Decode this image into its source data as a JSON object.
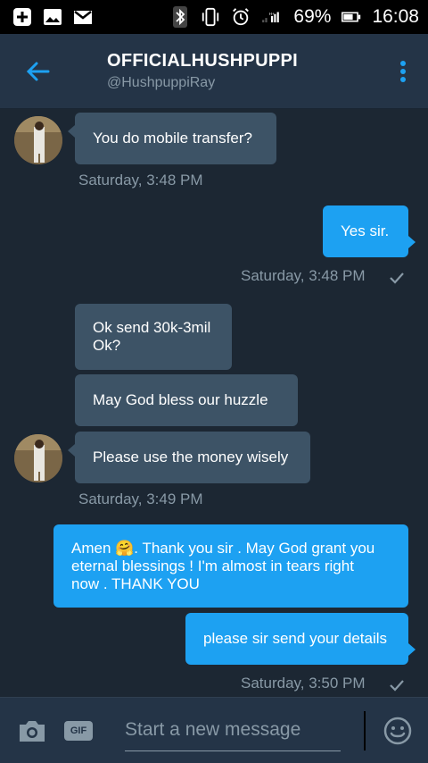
{
  "status_bar": {
    "battery_percent": "69%",
    "time": "16:08"
  },
  "header": {
    "title": "OFFICIALHUSHPUPPI",
    "handle": "@HushpuppiRay"
  },
  "messages": [
    {
      "direction": "in",
      "lines": [
        "You do mobile transfer?"
      ]
    },
    {
      "direction": "out",
      "lines": [
        "Yes sir."
      ]
    },
    {
      "direction": "in",
      "lines": [
        "Ok send 30k-3mil",
        "Ok?"
      ]
    },
    {
      "direction": "in",
      "lines": [
        "May God bless our huzzle"
      ]
    },
    {
      "direction": "in",
      "lines": [
        "Please use the money wisely"
      ]
    },
    {
      "direction": "out",
      "lines": [
        "Amen 🤗. Thank you sir . May God grant you",
        "eternal blessings ! I'm almost in tears right",
        "now . THANK YOU"
      ]
    },
    {
      "direction": "out",
      "lines": [
        "please sir send your details"
      ]
    }
  ],
  "timestamps": [
    "Saturday, 3:48 PM",
    "Saturday, 3:48 PM",
    "Saturday, 3:49 PM",
    "Saturday, 3:50 PM"
  ],
  "compose": {
    "placeholder": "Start a new message",
    "gif_label": "GIF"
  },
  "colors": {
    "header_bg": "#243447",
    "conversation_bg": "#1c2733",
    "incoming_bubble": "#3d5366",
    "outgoing_bubble": "#1da1f2",
    "accent": "#1da1f2",
    "muted_text": "#8899a6"
  },
  "icons": {
    "back": "arrow-left-icon",
    "menu": "more-vertical-icon",
    "camera": "camera-icon",
    "emoji": "emoji-icon",
    "read_receipt": "check-icon"
  }
}
